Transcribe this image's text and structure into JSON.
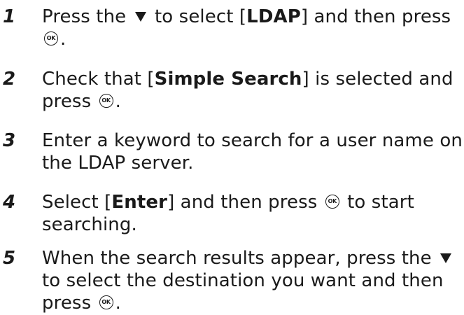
{
  "steps": [
    {
      "number": "1",
      "parts": {
        "a": "Press the",
        "b": "to select [",
        "c": "LDAP",
        "d": "] and then press",
        "e": "."
      }
    },
    {
      "number": "2",
      "parts": {
        "a": "Check that [",
        "b": "Simple Search",
        "c": "] is selected and press",
        "d": "."
      }
    },
    {
      "number": "3",
      "parts": {
        "a": "Enter a keyword to search for a user name on the LDAP server."
      }
    },
    {
      "number": "4",
      "parts": {
        "a": "Select [",
        "b": "Enter",
        "c": "] and then press",
        "d": "to start searching."
      }
    },
    {
      "number": "5",
      "parts": {
        "a": "When the search results appear, press the",
        "b": "to select the destination you want and then press",
        "c": "."
      }
    }
  ],
  "icons": {
    "ok_button_label": "OK",
    "down_arrow": "down-triangle-icon"
  },
  "colors": {
    "text": "#1a1a1a",
    "background": "#ffffff"
  }
}
